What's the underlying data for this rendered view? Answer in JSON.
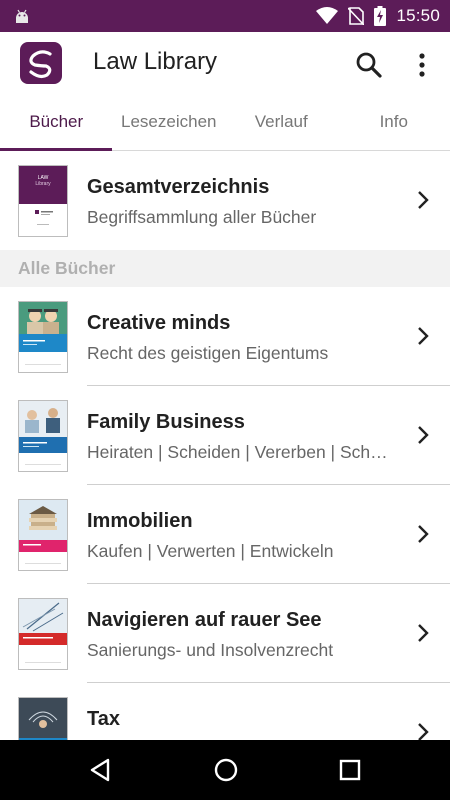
{
  "status_bar": {
    "time": "15:50",
    "icons": [
      "android-icon",
      "wifi-icon",
      "no-sim-icon",
      "battery-charging-icon"
    ]
  },
  "app_bar": {
    "title": "Law Library",
    "logo_icon": "library-logo-icon",
    "actions": [
      "search-icon",
      "more-vert-icon"
    ]
  },
  "tabs": [
    {
      "label": "Bücher",
      "active": true
    },
    {
      "label": "Lesezeichen",
      "active": false
    },
    {
      "label": "Verlauf",
      "active": false
    },
    {
      "label": "Info",
      "active": false
    }
  ],
  "index_item": {
    "title": "Gesamtverzeichnis",
    "subtitle": "Begriffsammlung aller Bücher",
    "cover_lines": [
      "LAW",
      "Library"
    ]
  },
  "section_header": "Alle Bücher",
  "books": [
    {
      "title": "Creative minds",
      "subtitle": "Recht des geistigen Eigentums",
      "band_color": "#1e88c8"
    },
    {
      "title": "Family Business",
      "subtitle": "Heiraten | Scheiden | Vererben | Sch…",
      "band_color": "#1f6fb0"
    },
    {
      "title": "Immobilien",
      "subtitle": "Kaufen | Verwerten | Entwickeln",
      "band_color": "#e0246c"
    },
    {
      "title": "Navigieren auf rauer See",
      "subtitle": "Sanierungs- und Insolvenzrecht",
      "band_color": "#d42a2a"
    },
    {
      "title": "Tax",
      "subtitle": "",
      "band_color": "#1e88c8"
    }
  ],
  "colors": {
    "primary": "#5c1c58",
    "tab_active_text": "#4d1a4a",
    "nav_bar": "#000000"
  },
  "nav_bar": [
    "back-icon",
    "home-icon",
    "recents-icon"
  ]
}
